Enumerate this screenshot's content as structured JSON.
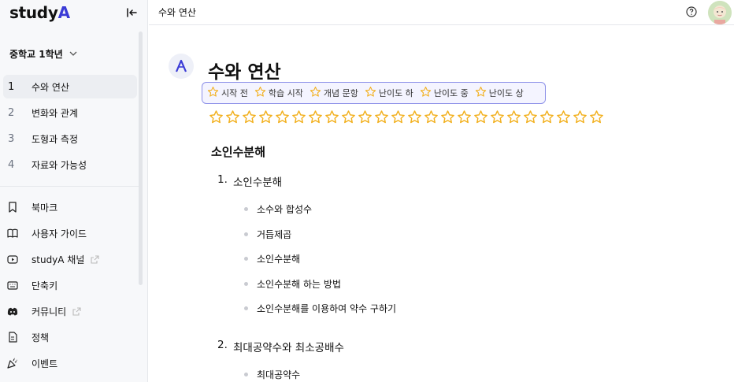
{
  "brand": {
    "text": "study",
    "accent": "A"
  },
  "grade": {
    "label": "중학교 1학년"
  },
  "chapters": [
    {
      "num": "1",
      "label": "수와 연산"
    },
    {
      "num": "2",
      "label": "변화와 관계"
    },
    {
      "num": "3",
      "label": "도형과 측정"
    },
    {
      "num": "4",
      "label": "자료와 가능성"
    }
  ],
  "links": [
    {
      "label": "북마크"
    },
    {
      "label": "사용자 가이드"
    },
    {
      "label": "studyA 채널"
    },
    {
      "label": "단축키"
    },
    {
      "label": "커뮤니티"
    },
    {
      "label": "정책"
    },
    {
      "label": "이벤트"
    }
  ],
  "topbar": {
    "title": "수와 연산"
  },
  "page": {
    "title": "수와 연산"
  },
  "tags": [
    {
      "label": "시작 전"
    },
    {
      "label": "학습 시작"
    },
    {
      "label": "개념 문항"
    },
    {
      "label": "난이도 하"
    },
    {
      "label": "난이도 중"
    },
    {
      "label": "난이도 상"
    }
  ],
  "section": {
    "heading": "소인수분해"
  },
  "outline": [
    {
      "num": "1.",
      "title": "소인수분해",
      "items": [
        "소수와 합성수",
        "거듭제곱",
        "소인수분해",
        "소인수분해 하는 방법",
        "소인수분해를 이용하여 약수 구하기"
      ]
    },
    {
      "num": "2.",
      "title": "최대공약수와 최소공배수",
      "items": [
        "최대공약수"
      ]
    }
  ],
  "colors": {
    "accent": "#3b3bd6",
    "star": "#f2b01e",
    "tag_border": "#8b8fe8"
  },
  "star_count": 24
}
